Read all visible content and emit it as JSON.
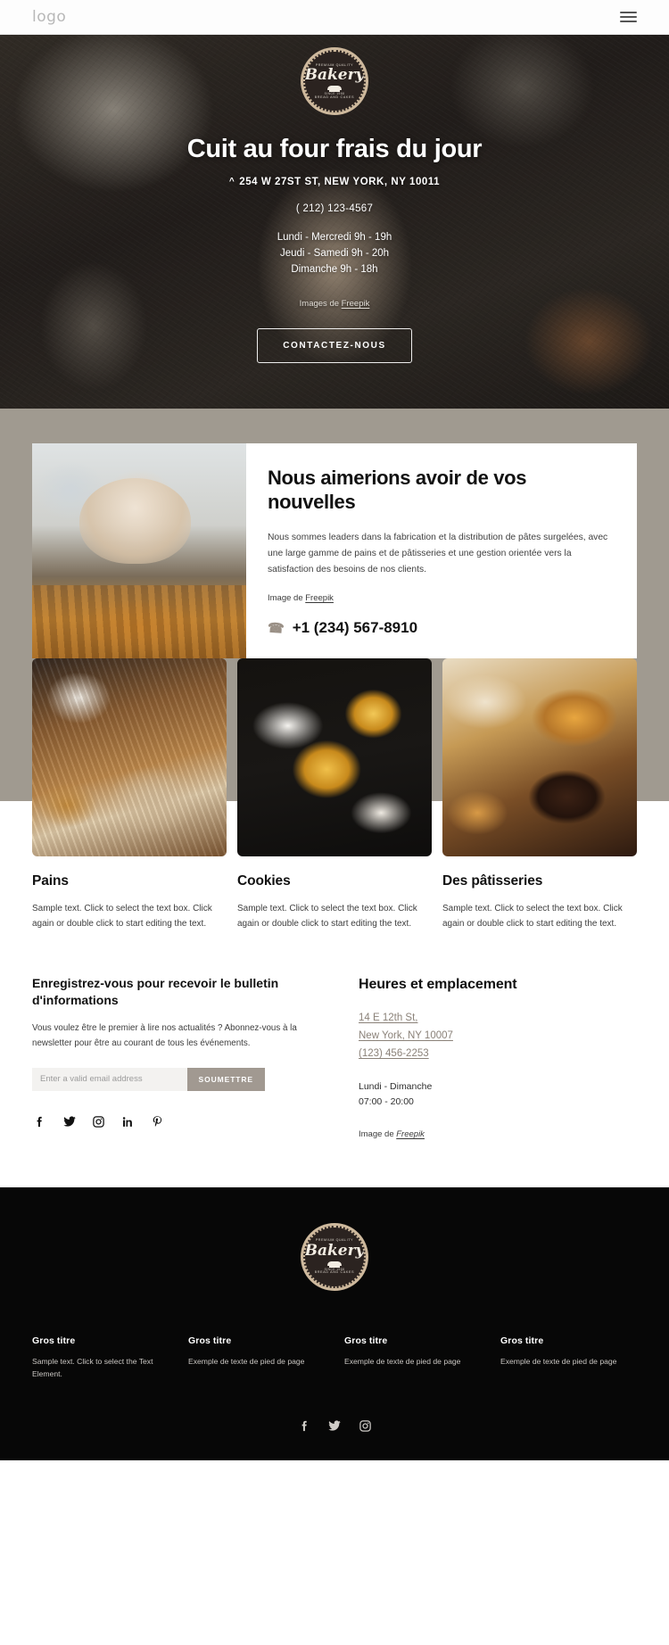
{
  "header": {
    "logo": "logo",
    "menu_icon": "hamburger-menu-icon"
  },
  "hero": {
    "badge": {
      "top_text": "PREMIUM QUALITY",
      "name": "Bakery",
      "since": "SINCE 1988",
      "bottom_text": "BREAD AND CAKES"
    },
    "title": "Cuit au four frais du jour",
    "address": "254 W 27ST ST, NEW YORK, NY 10011",
    "caret_icon": "caret-up-icon",
    "phone": "( 212) 123-4567",
    "hours": [
      "Lundi - Mercredi 9h - 19h",
      "Jeudi - Samedi 9h - 20h",
      "Dimanche 9h - 18h"
    ],
    "credit_prefix": "Images de ",
    "credit_link": "Freepik",
    "cta_label": "CONTACTEZ-NOUS"
  },
  "contact": {
    "title": "Nous aimerions avoir de vos nouvelles",
    "description": "Nous sommes leaders dans la fabrication et la distribution de pâtes surgelées, avec une large gamme de pains et de pâtisseries et une gestion orientée vers la satisfaction des besoins de nos clients.",
    "credit_prefix": "Image de ",
    "credit_link": "Freepik",
    "phone_icon": "phone-icon",
    "phone": "+1 (234) 567-8910",
    "image_alt": "baker-thumbs-up-photo"
  },
  "cards": [
    {
      "title": "Pains",
      "text": "Sample text. Click to select the text box. Click again or double click to start editing the text.",
      "image_alt": "breads-photo"
    },
    {
      "title": "Cookies",
      "text": "Sample text. Click to select the text box. Click again or double click to start editing the text.",
      "image_alt": "cookies-photo"
    },
    {
      "title": "Des pâtisseries",
      "text": "Sample text. Click to select the text box. Click again or double click to start editing the text.",
      "image_alt": "pastries-photo"
    }
  ],
  "newsletter": {
    "title": "Enregistrez-vous pour recevoir le bulletin d'informations",
    "description": "Vous voulez être le premier à lire nos actualités ? Abonnez-vous à la newsletter pour être au courant de tous les événements.",
    "input_placeholder": "Enter a valid email address",
    "input_value": "",
    "submit_label": "SOUMETTRE",
    "socials": [
      {
        "name": "facebook-icon",
        "glyph": "f"
      },
      {
        "name": "twitter-icon",
        "glyph": "🐦"
      },
      {
        "name": "instagram-icon",
        "glyph": "◱"
      },
      {
        "name": "linkedin-icon",
        "glyph": "in"
      },
      {
        "name": "pinterest-icon",
        "glyph": "P"
      }
    ]
  },
  "hours_location": {
    "title": "Heures et emplacement",
    "address_line1": "14 E 12th St,",
    "address_line2": "New York, NY 10007",
    "phone": "(123) 456-2253",
    "days": "Lundi - Dimanche",
    "times": "07:00 - 20:00",
    "credit_prefix": "Image de ",
    "credit_link": "Freepik"
  },
  "footer": {
    "badge": {
      "top_text": "PREMIUM QUALITY",
      "name": "Bakery",
      "since": "SINCE 1988",
      "bottom_text": "BREAD AND CAKES"
    },
    "columns": [
      {
        "title": "Gros titre",
        "text": "Sample text. Click to select the Text Element."
      },
      {
        "title": "Gros titre",
        "text": "Exemple de texte de pied de page"
      },
      {
        "title": "Gros titre",
        "text": "Exemple de texte de pied de page"
      },
      {
        "title": "Gros titre",
        "text": "Exemple de texte de pied de page"
      }
    ],
    "socials": [
      {
        "name": "facebook-icon",
        "glyph": "f"
      },
      {
        "name": "twitter-icon",
        "glyph": "🐦"
      },
      {
        "name": "instagram-icon",
        "glyph": "◱"
      }
    ]
  },
  "colors": {
    "band_taupe": "#a09a90",
    "accent_button": "#a19991",
    "link_muted": "#8b8279",
    "footer_bg": "#070707"
  }
}
